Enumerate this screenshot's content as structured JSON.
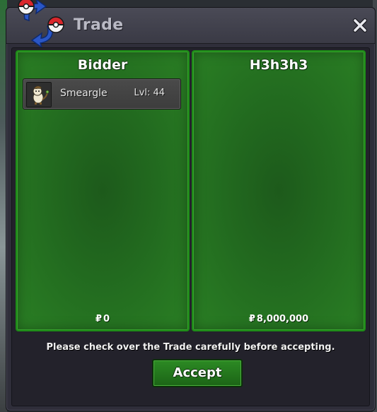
{
  "window": {
    "title": "Trade",
    "close_icon": "close-icon",
    "logo_icon": "trade-arrows-pokeball-icon"
  },
  "left_panel": {
    "title": "Bidder",
    "items": [
      {
        "icon": "smeargle-sprite-icon",
        "name": "Smeargle",
        "level": "Lvl: 44"
      }
    ],
    "money_symbol": "₽",
    "money": "0"
  },
  "right_panel": {
    "title": "H3h3h3",
    "items": [],
    "money_symbol": "₽",
    "money": "8,000,000"
  },
  "notice": "Please check over the Trade carefully before accepting.",
  "accept_label": "Accept",
  "colors": {
    "panel_green": "#226a1f",
    "panel_border": "#1d8a17",
    "window_bg": "#2f2e3a",
    "accept_green": "#2c8a24",
    "title_text": "#b9b9c4"
  }
}
